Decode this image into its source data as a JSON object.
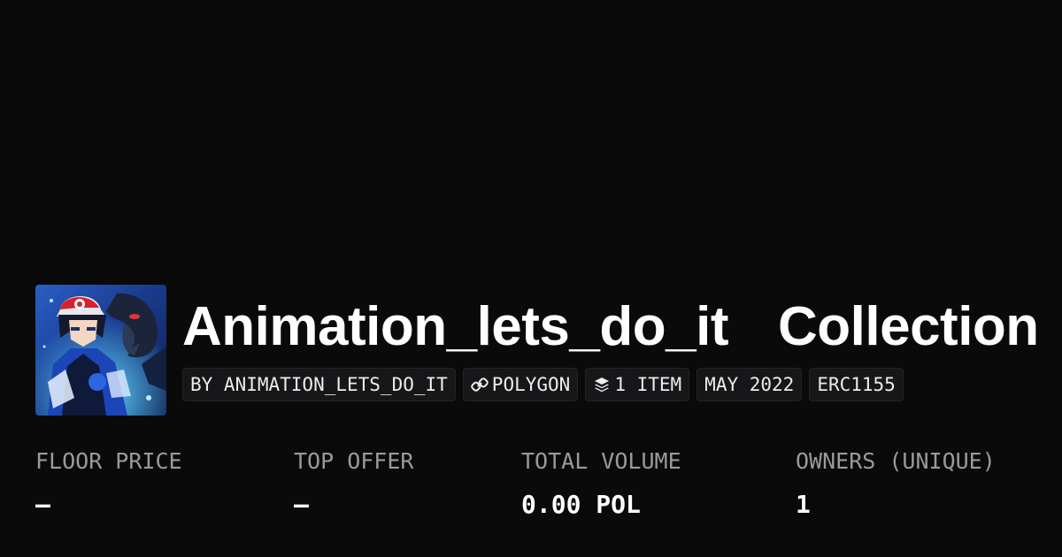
{
  "collection": {
    "name": "Animation_lets_do_it",
    "suffix": "Collection",
    "avatar_alt": "collection-avatar"
  },
  "tags": [
    {
      "label": "BY ANIMATION_LETS_DO_IT",
      "icon": ""
    },
    {
      "label": "POLYGON",
      "icon": "chain-link-icon"
    },
    {
      "label": "1 ITEM",
      "icon": "layers-icon"
    },
    {
      "label": "MAY 2022",
      "icon": ""
    },
    {
      "label": "ERC1155",
      "icon": ""
    }
  ],
  "stats": [
    {
      "label": "FLOOR PRICE",
      "value": "–"
    },
    {
      "label": "TOP OFFER",
      "value": "–"
    },
    {
      "label": "TOTAL VOLUME",
      "value": "0.00 POL"
    },
    {
      "label": "OWNERS (UNIQUE)",
      "value": "1"
    }
  ],
  "colors": {
    "background": "#0a0a0b",
    "tag_background": "#17171a",
    "label_gray": "#9a9a9e",
    "text_white": "#ffffff"
  }
}
